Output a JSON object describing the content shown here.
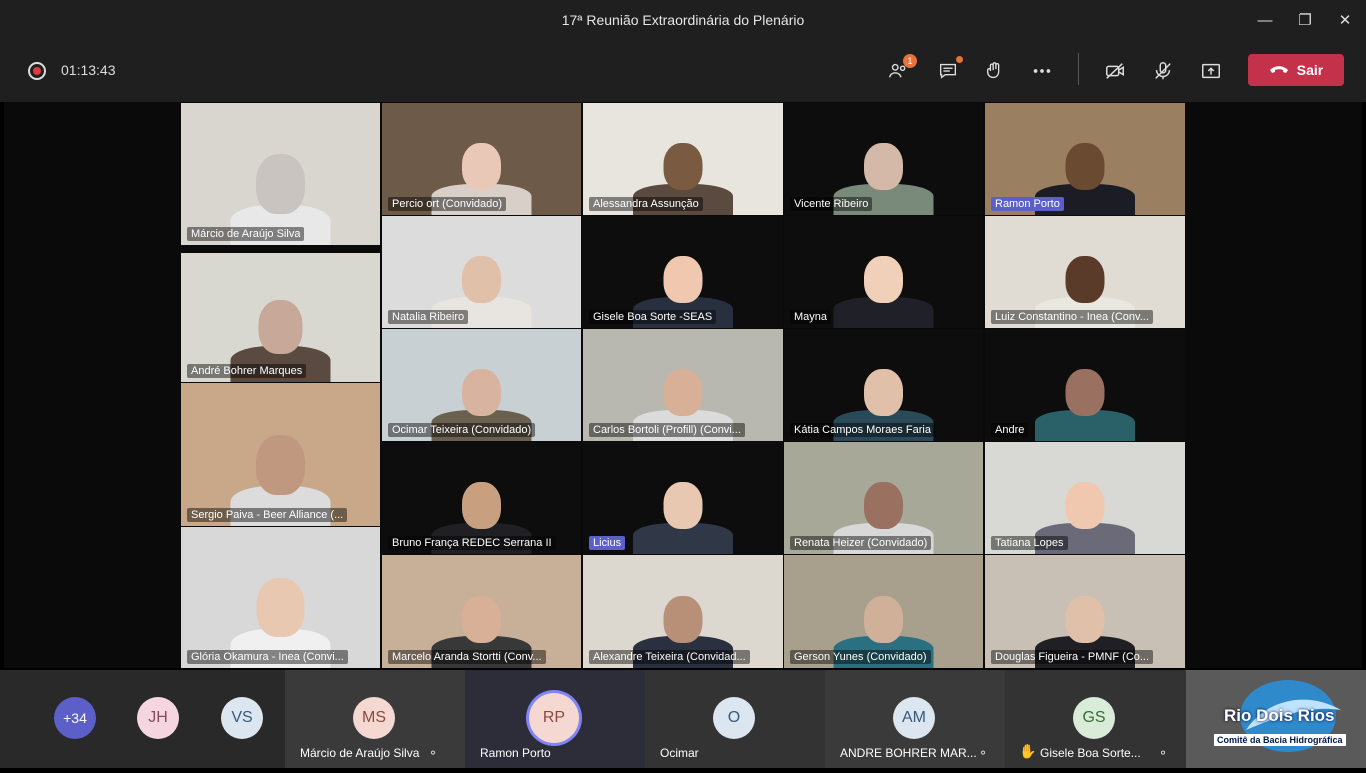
{
  "window": {
    "title": "17ª Reunião Extraordinária do Plenário"
  },
  "toolbar": {
    "timer": "01:13:43",
    "participants_badge": "1",
    "leave_label": "Sair"
  },
  "tiles": [
    {
      "name": "Márcio de Araújo Silva"
    },
    {
      "name": "Percio ort (Convidado)"
    },
    {
      "name": "Alessandra Assunção"
    },
    {
      "name": "Vicente Ribeiro"
    },
    {
      "name": "Ramon Porto"
    },
    {
      "name": "André Bohrer Marques"
    },
    {
      "name": "Natalia Ribeiro"
    },
    {
      "name": "Gisele Boa Sorte -SEAS"
    },
    {
      "name": "Mayna"
    },
    {
      "name": "Luiz Constantino - Inea (Conv..."
    },
    {
      "name": "Ocimar Teixeira (Convidado)"
    },
    {
      "name": "Carlos Bortoli (Profill) (Convi..."
    },
    {
      "name": "Kátia Campos Moraes Faria"
    },
    {
      "name": "Andre"
    },
    {
      "name": "Sergio Paiva - Beer Alliance (..."
    },
    {
      "name": "Bruno França REDEC Serrana II"
    },
    {
      "name": "Licius"
    },
    {
      "name": "Renata Heizer (Convidado)"
    },
    {
      "name": "Tatiana Lopes"
    },
    {
      "name": "Glória Okamura - Inea (Convi..."
    },
    {
      "name": "Marcelo Aranda Stortti (Conv..."
    },
    {
      "name": "Alexandre Teixeira (Convidad..."
    },
    {
      "name": "Gerson Yunes (Convidado)"
    },
    {
      "name": "Douglas Figueira - PMNF (Co..."
    }
  ],
  "bottom": {
    "overflow": "+34",
    "small_avatars": [
      "JH",
      "VS"
    ],
    "participants": [
      {
        "initials": "MS",
        "name": "Márcio de Araújo Silva"
      },
      {
        "initials": "RP",
        "name": "Ramon Porto"
      },
      {
        "initials": "O",
        "name": "Ocimar"
      },
      {
        "initials": "AM",
        "name": "ANDRE BOHRER MAR..."
      },
      {
        "initials": "GS",
        "name": "Gisele Boa Sorte..."
      }
    ]
  },
  "logo": {
    "title": "Rio Dois Rios",
    "subtitle": "Comitê da Bacia Hidrográfica"
  },
  "colors": {
    "leave": "#c4314b",
    "accent": "#5b5fc7",
    "badge": "#e8713c"
  }
}
